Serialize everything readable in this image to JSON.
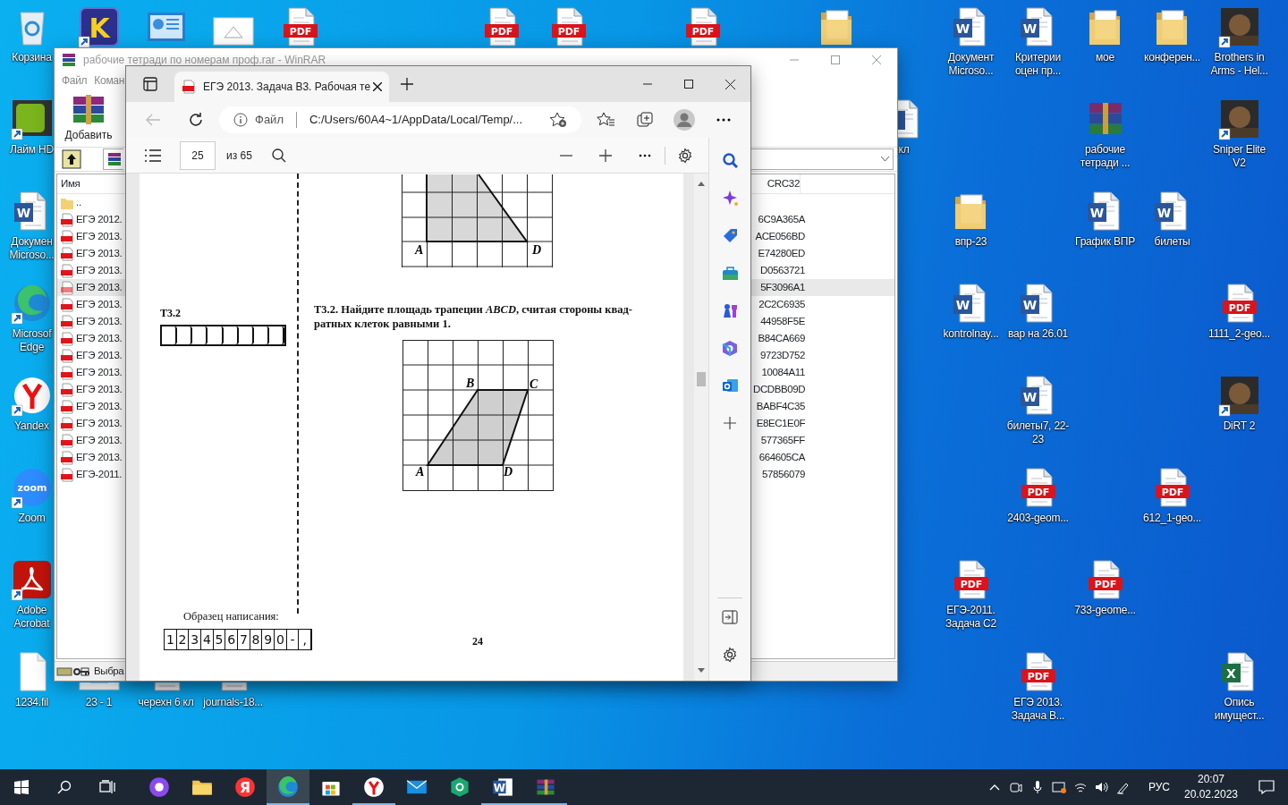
{
  "desktop_icons": [
    {
      "kind": "recycle",
      "label": "Корзина",
      "shortcut": false
    },
    {
      "kind": "letter-app",
      "glyph": "K",
      "shortcut": true
    },
    {
      "kind": "chart-app",
      "shortcut": false
    },
    {
      "kind": "image",
      "shortcut": false
    },
    {
      "kind": "pdf",
      "glyph": "PDF",
      "shortcut": false
    },
    {
      "kind": "pdf",
      "glyph": "PDF",
      "shortcut": false
    },
    {
      "kind": "pdf",
      "glyph": "PDF",
      "shortcut": false
    },
    {
      "kind": "pdf",
      "glyph": "PDF",
      "shortcut": false
    },
    {
      "kind": "folder",
      "shortcut": false
    },
    {
      "kind": "word",
      "glyph": "W",
      "label": "Документ Microso...",
      "shortcut": false
    },
    {
      "kind": "word",
      "glyph": "W",
      "label": "Критерии оцен пр...",
      "shortcut": false
    },
    {
      "kind": "folder",
      "label": "мое",
      "shortcut": false
    },
    {
      "kind": "folder",
      "label": "конферен...",
      "shortcut": false
    },
    {
      "kind": "game",
      "label": "Brothers in Arms - Hel...",
      "shortcut": true
    },
    {
      "kind": "tv-app",
      "label": "Лайм HD",
      "shortcut": true
    },
    {
      "kind": "word",
      "label": "кл"
    },
    {
      "kind": "archive",
      "label": "рабочие тетради ...",
      "shortcut": false
    },
    {
      "kind": "game",
      "label": "Sniper Elite V2",
      "shortcut": true
    },
    {
      "kind": "word",
      "glyph": "W",
      "label": "Докумен Microso...",
      "shortcut": false
    },
    {
      "kind": "folder",
      "label": "впр-23",
      "shortcut": false
    },
    {
      "kind": "word",
      "glyph": "W",
      "label": "График ВПР",
      "shortcut": false
    },
    {
      "kind": "word",
      "glyph": "W",
      "label": "билеты",
      "shortcut": false
    },
    {
      "kind": "edge",
      "label": "Microsof Edge",
      "shortcut": true
    },
    {
      "kind": "word",
      "glyph": "W",
      "label": "kontrolnay...",
      "shortcut": false
    },
    {
      "kind": "word",
      "glyph": "W",
      "label": "вар на 26.01",
      "shortcut": false
    },
    {
      "kind": "pdf",
      "glyph": "PDF",
      "label": "1111_2-geo...",
      "shortcut": false
    },
    {
      "kind": "yandex",
      "label": "Yandex",
      "shortcut": true
    },
    {
      "kind": "word",
      "glyph": "W",
      "label": "билеты7, 22-23",
      "shortcut": false
    },
    {
      "kind": "game",
      "label": "DiRT 2",
      "shortcut": true
    },
    {
      "kind": "zoom",
      "glyph": "zoom",
      "label": "Zoom",
      "shortcut": true
    },
    {
      "kind": "pdf",
      "glyph": "PDF",
      "label": "2403-geom...",
      "shortcut": false
    },
    {
      "kind": "pdf",
      "glyph": "PDF",
      "label": "612_1-geo...",
      "shortcut": false
    },
    {
      "kind": "acrobat",
      "label": "Adobe Acrobat",
      "shortcut": true
    },
    {
      "kind": "pdf",
      "glyph": "PDF",
      "label": "ЕГЭ-2011. Задача C2",
      "shortcut": false
    },
    {
      "kind": "pdf",
      "glyph": "PDF",
      "label": "733-geome...",
      "shortcut": false
    },
    {
      "kind": "file",
      "label": "1234.fil",
      "shortcut": false
    },
    {
      "kind": "image",
      "label": "23 - 1",
      "shortcut": false
    },
    {
      "kind": "word",
      "label": "черехн 6 кл",
      "shortcut": false
    },
    {
      "kind": "pdf",
      "label": "journals-18...",
      "shortcut": false
    },
    {
      "kind": "pdf",
      "glyph": "PDF",
      "label": "ЕГЭ 2013. Задача В...",
      "shortcut": false
    },
    {
      "kind": "excel",
      "glyph": "X",
      "label": "Опись имущест...",
      "shortcut": false
    }
  ],
  "winrar": {
    "title": "рабочие тетради по номерам проф.rar - WinRAR",
    "menu": [
      "Файл",
      "Коман"
    ],
    "toolbar": [
      {
        "label": "Добавить"
      }
    ],
    "columns": [
      "Имя",
      "CRC32"
    ],
    "rows": [
      {
        "kind": "up",
        "name": "..",
        "selected": false
      },
      {
        "kind": "pdf",
        "name": "ЕГЭ 2012.",
        "crc": "6C9A365A",
        "selected": false
      },
      {
        "kind": "pdf",
        "name": "ЕГЭ 2013.",
        "crc": "ACE056BD",
        "selected": false
      },
      {
        "kind": "pdf",
        "name": "ЕГЭ 2013.",
        "crc": "E74280ED",
        "selected": false
      },
      {
        "kind": "pdf",
        "name": "ЕГЭ 2013.",
        "crc": "D0563721",
        "selected": false
      },
      {
        "kind": "pdf",
        "name": "ЕГЭ 2013.",
        "crc": "5F3096A1",
        "selected": true
      },
      {
        "kind": "pdf",
        "name": "ЕГЭ 2013.",
        "crc": "2C2C6935",
        "selected": false
      },
      {
        "kind": "pdf",
        "name": "ЕГЭ 2013.",
        "crc": "44958F5E",
        "selected": false
      },
      {
        "kind": "pdf",
        "name": "ЕГЭ 2013.",
        "crc": "B84CA669",
        "selected": false
      },
      {
        "kind": "pdf",
        "name": "ЕГЭ 2013.",
        "crc": "9723D752",
        "selected": false
      },
      {
        "kind": "pdf",
        "name": "ЕГЭ 2013.",
        "crc": "10084A11",
        "selected": false
      },
      {
        "kind": "pdf",
        "name": "ЕГЭ 2013.",
        "crc": "DCDBB09D",
        "selected": false
      },
      {
        "kind": "pdf",
        "name": "ЕГЭ 2013.",
        "crc": "BABF4C35",
        "selected": false
      },
      {
        "kind": "pdf",
        "name": "ЕГЭ 2013.",
        "crc": "E8EC1E0F",
        "selected": false
      },
      {
        "kind": "pdf",
        "name": "ЕГЭ 2013.",
        "crc": "577365FF",
        "selected": false
      },
      {
        "kind": "pdf",
        "name": "ЕГЭ 2013.",
        "crc": "664605CA",
        "selected": false
      },
      {
        "kind": "pdf",
        "name": "ЕГЭ-2011.",
        "crc": "57856079",
        "selected": false
      }
    ],
    "status": "Выбра"
  },
  "edge": {
    "tab_title": "ЕГЭ 2013. Задача В3. Рабочая те",
    "can_go_back": false,
    "address_scheme": "Файл",
    "address": "C:/Users/60A4~1/AppData/Local/Temp/...",
    "page": "25",
    "page_total": "из 65",
    "pdf_page": {
      "answer_label": "Т3.2",
      "sample_caption": "Образец написания:",
      "sample_chars": [
        "1",
        "2",
        "3",
        "4",
        "5",
        "6",
        "7",
        "8",
        "9",
        "0",
        "-",
        ","
      ],
      "figure_top": {
        "vertices": [
          "A",
          "D"
        ]
      },
      "task_text": "**Т3.2.** Найдите площадь трапеции *ABCD*, считая стороны квад-ратных клеток равными 1.",
      "figure_main": {
        "vertices": [
          "B",
          "C",
          "A",
          "D"
        ]
      },
      "page_number": "24"
    }
  },
  "taskbar": {
    "apps": [
      {
        "running": false,
        "active": false
      },
      {
        "running": false,
        "active": false
      },
      {
        "running": false,
        "active": false,
        "glyph": "Я"
      },
      {
        "running": true,
        "active": true
      },
      {
        "running": false,
        "active": false
      },
      {
        "running": true,
        "active": false
      },
      {
        "running": false,
        "active": false
      },
      {
        "running": false,
        "active": false
      },
      {
        "running": true,
        "active": false,
        "glyph": "W"
      },
      {
        "running": true,
        "active": false
      }
    ],
    "language": "РУС",
    "time": "20:07",
    "date": "20.02.2023"
  }
}
